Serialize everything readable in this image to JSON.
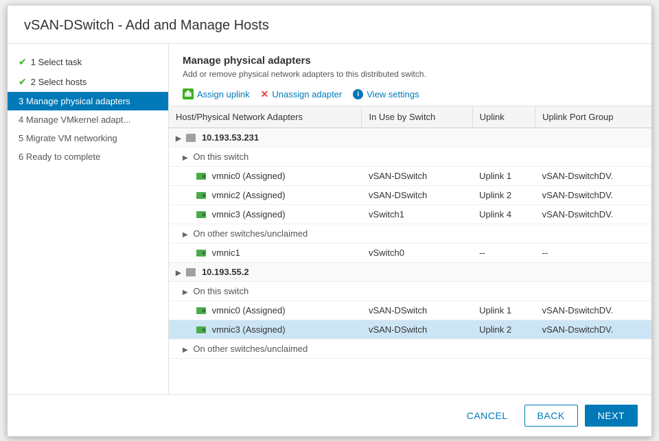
{
  "dialog": {
    "title": "vSAN-DSwitch - Add and Manage Hosts"
  },
  "sidebar": {
    "items": [
      {
        "id": "step1",
        "label": "1 Select task",
        "state": "done"
      },
      {
        "id": "step2",
        "label": "2 Select hosts",
        "state": "done"
      },
      {
        "id": "step3",
        "label": "3 Manage physical adapters",
        "state": "active"
      },
      {
        "id": "step4",
        "label": "4 Manage VMkernel adapt...",
        "state": "todo"
      },
      {
        "id": "step5",
        "label": "5 Migrate VM networking",
        "state": "todo"
      },
      {
        "id": "step6",
        "label": "6 Ready to complete",
        "state": "todo"
      }
    ]
  },
  "main": {
    "section_title": "Manage physical adapters",
    "section_desc": "Add or remove physical network adapters to this distributed switch.",
    "toolbar": {
      "assign_label": "Assign uplink",
      "unassign_label": "Unassign adapter",
      "view_label": "View settings"
    },
    "table": {
      "columns": [
        "Host/Physical Network Adapters",
        "In Use by Switch",
        "Uplink",
        "Uplink Port Group"
      ],
      "rows": [
        {
          "type": "host",
          "indent": 0,
          "col1": "10.193.53.231",
          "col2": "",
          "col3": "",
          "col4": ""
        },
        {
          "type": "subgroup",
          "indent": 1,
          "col1": "On this switch",
          "col2": "",
          "col3": "",
          "col4": ""
        },
        {
          "type": "data",
          "indent": 2,
          "col1": "vmnic0 (Assigned)",
          "col2": "vSAN-DSwitch",
          "col3": "Uplink 1",
          "col4": "vSAN-DswitchDV.",
          "selected": false
        },
        {
          "type": "data",
          "indent": 2,
          "col1": "vmnic2 (Assigned)",
          "col2": "vSAN-DSwitch",
          "col3": "Uplink 2",
          "col4": "vSAN-DswitchDV.",
          "selected": false
        },
        {
          "type": "data",
          "indent": 2,
          "col1": "vmnic3 (Assigned)",
          "col2": "vSwitch1",
          "col3": "Uplink 4",
          "col4": "vSAN-DswitchDV.",
          "selected": false
        },
        {
          "type": "subgroup",
          "indent": 1,
          "col1": "On other switches/unclaimed",
          "col2": "",
          "col3": "",
          "col4": ""
        },
        {
          "type": "data",
          "indent": 2,
          "col1": "vmnic1",
          "col2": "vSwitch0",
          "col3": "--",
          "col4": "--",
          "selected": false
        },
        {
          "type": "host",
          "indent": 0,
          "col1": "10.193.55.2",
          "col2": "",
          "col3": "",
          "col4": ""
        },
        {
          "type": "subgroup",
          "indent": 1,
          "col1": "On this switch",
          "col2": "",
          "col3": "",
          "col4": ""
        },
        {
          "type": "data",
          "indent": 2,
          "col1": "vmnic0 (Assigned)",
          "col2": "vSAN-DSwitch",
          "col3": "Uplink 1",
          "col4": "vSAN-DswitchDV.",
          "selected": false
        },
        {
          "type": "data",
          "indent": 2,
          "col1": "vmnic3 (Assigned)",
          "col2": "vSAN-DSwitch",
          "col3": "Uplink 2",
          "col4": "vSAN-DswitchDV.",
          "selected": true
        },
        {
          "type": "subgroup",
          "indent": 1,
          "col1": "On other switches/unclaimed",
          "col2": "",
          "col3": "",
          "col4": ""
        }
      ]
    }
  },
  "footer": {
    "cancel_label": "CANCEL",
    "back_label": "BACK",
    "next_label": "NEXT"
  },
  "colors": {
    "active_bg": "#0079b8",
    "link_color": "#0079b8",
    "selected_row": "#cce5f5",
    "check_color": "#3db11f"
  }
}
